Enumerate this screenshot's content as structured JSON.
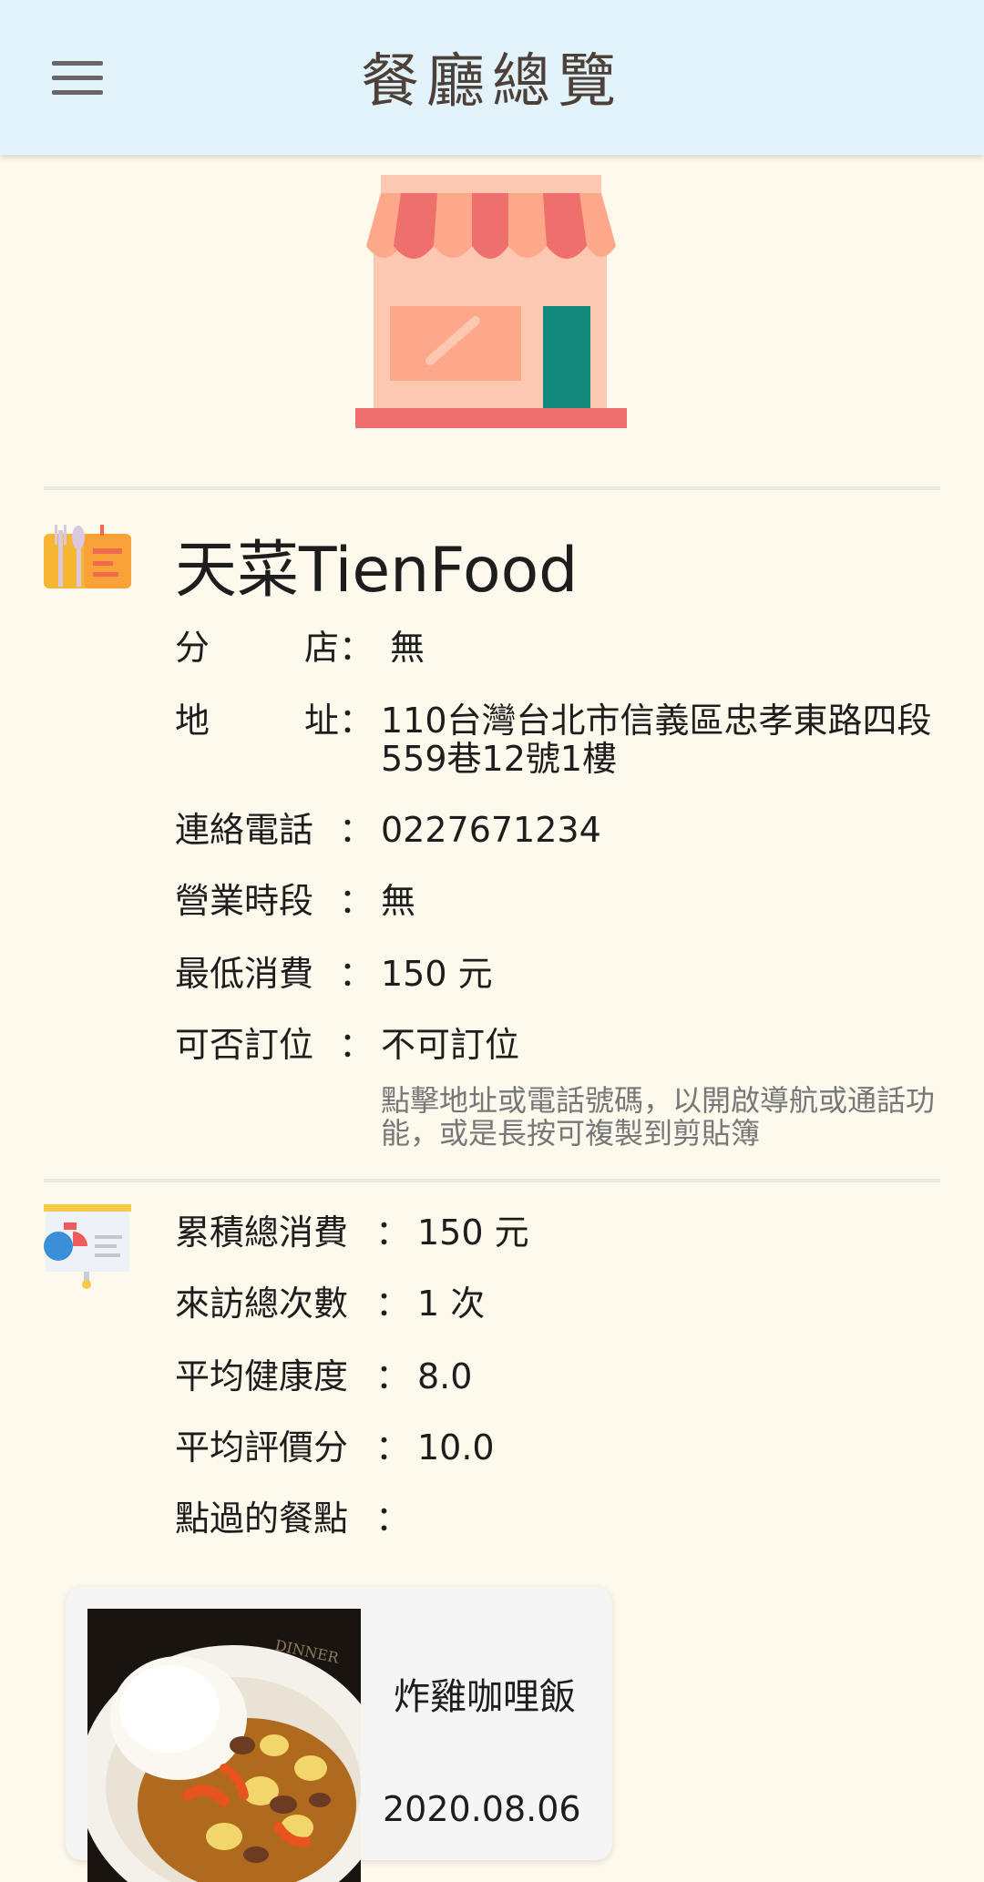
{
  "appbar": {
    "title": "餐廳總覽"
  },
  "icons": {
    "menu": "hamburger-menu-icon",
    "hero": "storefront-icon",
    "restaurant": "restaurant-sign-icon",
    "stats": "presentation-chart-icon"
  },
  "colors": {
    "appbar_bg": "#e3f3fb",
    "page_bg": "#fdf9ec",
    "hint_text": "#777777"
  },
  "restaurant": {
    "name": "天菜TienFood",
    "branch_label_1": "分",
    "branch_label_2": "店",
    "branch_value": "無",
    "address_label_1": "地",
    "address_label_2": "址",
    "address_value": "110台灣台北市信義區忠孝東路四段559巷12號1樓",
    "phone_label": "連絡電話",
    "phone_value": "0227671234",
    "hours_label": "營業時段",
    "hours_value": "無",
    "min_spend_label": "最低消費",
    "min_spend_value": "150 元",
    "reservation_label": "可否訂位",
    "reservation_value": "不可訂位",
    "colon": "：",
    "hint": "點擊地址或電話號碼，以開啟導航或通話功能，或是長按可複製到剪貼簿"
  },
  "stats": {
    "total_spend_label": "累積總消費",
    "total_spend_value": "150 元",
    "visits_label": "來訪總次數",
    "visits_value": "1 次",
    "health_label": "平均健康度",
    "health_value": "8.0",
    "rating_label": "平均評價分",
    "rating_value": "10.0",
    "ordered_label": "點過的餐點",
    "colon": "："
  },
  "meals": [
    {
      "name": "炸雞咖哩飯",
      "date": "2020.08.06",
      "plate_text": "DINNER"
    }
  ]
}
